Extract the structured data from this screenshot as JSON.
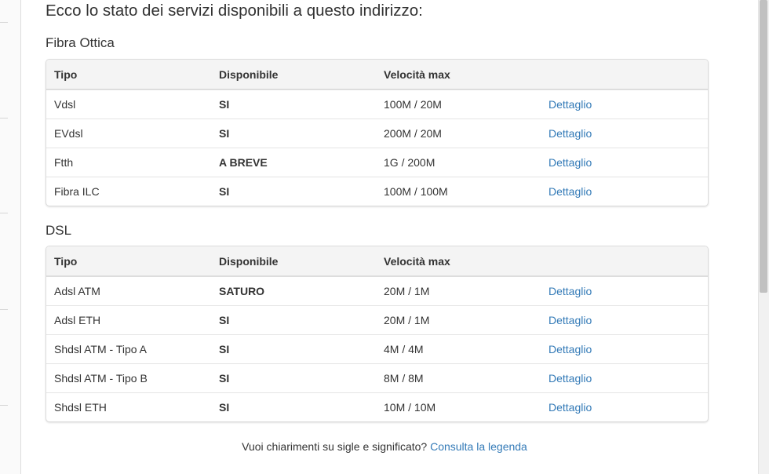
{
  "heading": "Ecco lo stato dei servizi disponibili a questo indirizzo:",
  "columns": {
    "tipo": "Tipo",
    "disponibile": "Disponibile",
    "velocita": "Velocità max"
  },
  "sections": [
    {
      "title": "Fibra Ottica",
      "rows": [
        {
          "tipo": "Vdsl",
          "disponibile": "SI",
          "velocita": "100M / 20M",
          "link": "Dettaglio"
        },
        {
          "tipo": "EVdsl",
          "disponibile": "SI",
          "velocita": "200M / 20M",
          "link": "Dettaglio"
        },
        {
          "tipo": "Ftth",
          "disponibile": "A BREVE",
          "velocita": "1G / 200M",
          "link": "Dettaglio"
        },
        {
          "tipo": "Fibra ILC",
          "disponibile": "SI",
          "velocita": "100M / 100M",
          "link": "Dettaglio"
        }
      ]
    },
    {
      "title": "DSL",
      "rows": [
        {
          "tipo": "Adsl ATM",
          "disponibile": "SATURO",
          "velocita": "20M / 1M",
          "link": "Dettaglio"
        },
        {
          "tipo": "Adsl ETH",
          "disponibile": "SI",
          "velocita": "20M / 1M",
          "link": "Dettaglio"
        },
        {
          "tipo": "Shdsl ATM - Tipo A",
          "disponibile": "SI",
          "velocita": "4M / 4M",
          "link": "Dettaglio"
        },
        {
          "tipo": "Shdsl ATM - Tipo B",
          "disponibile": "SI",
          "velocita": "8M / 8M",
          "link": "Dettaglio"
        },
        {
          "tipo": "Shdsl ETH",
          "disponibile": "SI",
          "velocita": "10M / 10M",
          "link": "Dettaglio"
        }
      ]
    }
  ],
  "legend": {
    "question": "Vuoi chiarimenti su sigle e significato?",
    "link": "Consulta la legenda"
  },
  "colors": {
    "link": "#337ab7",
    "header_bg": "#f4f4f4",
    "border": "#dcdcdc"
  }
}
